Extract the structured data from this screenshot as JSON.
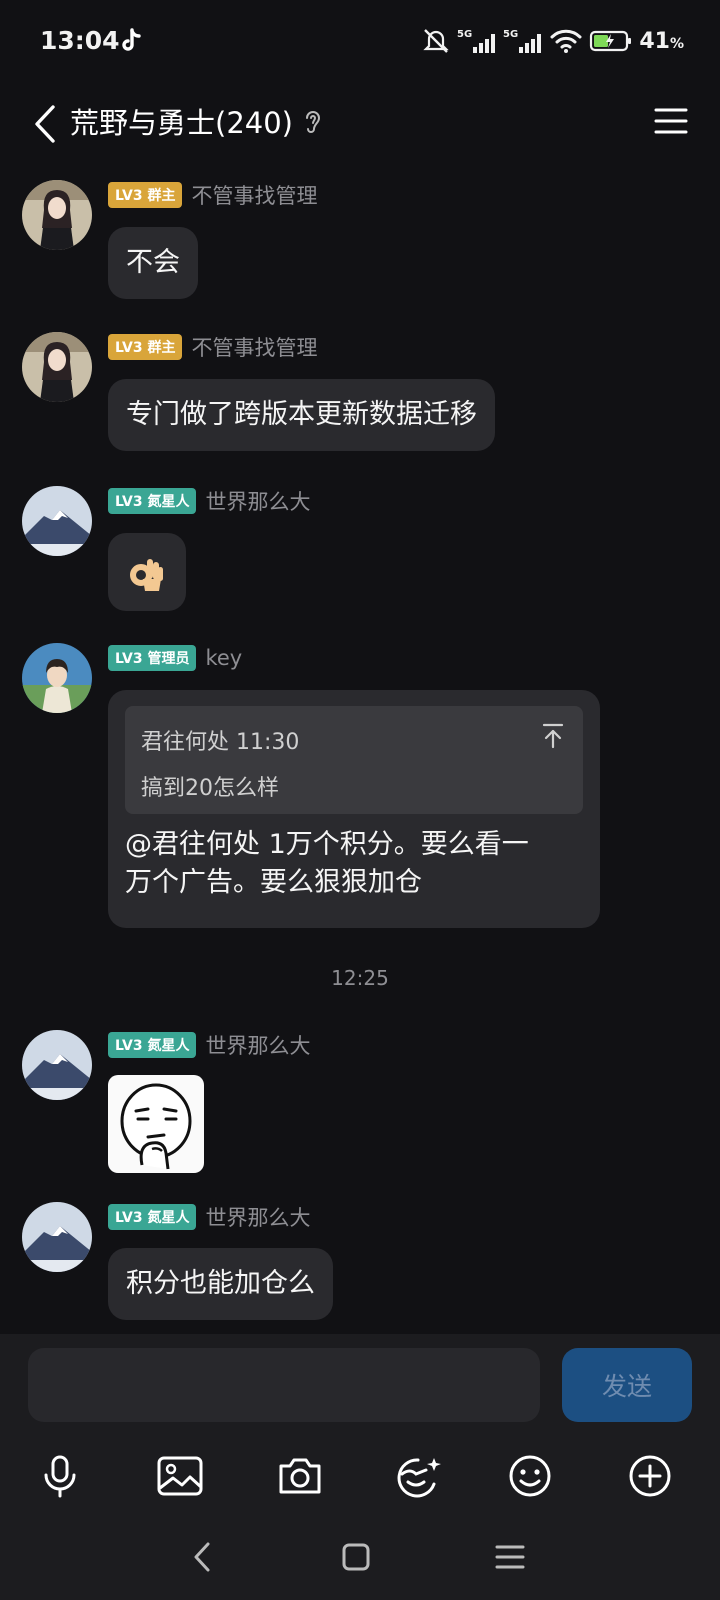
{
  "status_bar": {
    "time": "13:04",
    "battery_percent": "41",
    "battery_unit": "%",
    "network_labels": [
      "5G",
      "5G"
    ],
    "icons": [
      "tiktok-icon",
      "mute-icon",
      "signal-icon",
      "wifi-icon",
      "battery-icon"
    ]
  },
  "header": {
    "title": "荒野与勇士(240)",
    "icons": [
      "back-icon",
      "ear-icon",
      "menu-icon"
    ]
  },
  "messages": [
    {
      "badge": "LV3 群主",
      "badge_color": "#d9a53a",
      "sender": "不管事找管理",
      "text": "不会"
    },
    {
      "badge": "LV3 群主",
      "badge_color": "#d9a53a",
      "sender": "不管事找管理",
      "text": "专门做了跨版本更新数据迁移"
    },
    {
      "badge": "LV3 氮星人",
      "badge_color": "#3aa694",
      "sender": "世界那么大",
      "emoji": "👌"
    },
    {
      "badge": "LV3 管理员",
      "badge_color": "#3aa694",
      "sender": "key",
      "quote": {
        "author_time": "君往何处 11:30",
        "text": "搞到20怎么样"
      },
      "text_line1": "@君往何处 1万个积分。要么看一",
      "text_line2": "万个广告。要么狠狠加仓"
    },
    {
      "badge": "LV3 氮星人",
      "badge_color": "#3aa694",
      "sender": "世界那么大",
      "sticker": "thinking-face-sticker"
    },
    {
      "badge": "LV3 氮星人",
      "badge_color": "#3aa694",
      "sender": "世界那么大",
      "text": "积分也能加仓么"
    }
  ],
  "time_separator": "12:25",
  "input": {
    "placeholder": "",
    "send_label": "发送"
  },
  "toolbar": [
    "microphone-icon",
    "image-icon",
    "camera-icon",
    "sticker-icon",
    "emoji-icon",
    "plus-icon"
  ],
  "nav_bar": [
    "nav-back-icon",
    "nav-home-icon",
    "nav-recents-icon"
  ],
  "colors": {
    "background": "#111114",
    "bubble": "#2a2a2e",
    "send_button": "#1c4f82"
  }
}
